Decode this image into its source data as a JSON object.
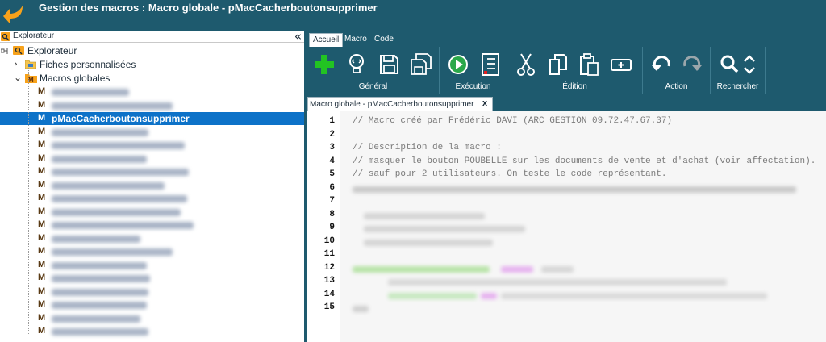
{
  "window": {
    "title": "Gestion des macros : Macro globale - pMacCacherboutonsupprimer"
  },
  "explorer": {
    "header": "Explorateur",
    "collapse_glyph": "«",
    "root": "Explorateur",
    "fiches": "Fiches personnalisées",
    "macros_globales": "Macros globales",
    "macro_badge": "M",
    "selected_item": "pMacCacherboutonsupprimer",
    "blurred_rows_before": 2,
    "blurred_rows_after": 16
  },
  "ribbon": {
    "tabs": [
      "Accueil",
      "Macro",
      "Code"
    ],
    "active_tab": "Accueil",
    "groups": {
      "general": "Général",
      "execution": "Exécution",
      "edition": "Édition",
      "action": "Action",
      "search": "Rechercher"
    },
    "icons": [
      "add-icon",
      "idea-icon",
      "save-icon",
      "save-all-icon",
      "run-icon",
      "debug-list-icon",
      "cut-icon",
      "copy-icon",
      "paste-icon",
      "insert-icon",
      "undo-icon",
      "redo-icon",
      "search-icon",
      "up-down-icon"
    ]
  },
  "doc_tab": {
    "label": "Macro globale - pMacCacherboutonsupprimer",
    "close": "x"
  },
  "editor": {
    "line_numbers": [
      "1",
      "2",
      "3",
      "4",
      "5",
      "6",
      "7",
      "8",
      "9",
      "10",
      "11",
      "12",
      "13",
      "14",
      "15"
    ],
    "lines": [
      "// Macro créé par Frédéric DAVI (ARC GESTION 09.72.47.67.37)",
      "",
      "// Description de la macro :",
      "// masquer le bouton POUBELLE sur les documents de vente et d'achat (voir affectation).",
      "// sauf pour 2 utilisateurs. On teste le code représentant."
    ]
  },
  "colors": {
    "chrome": "#1e5a6e",
    "selection": "#0d72c8",
    "accent_orange": "#f7a21b",
    "add_green": "#22c322"
  }
}
